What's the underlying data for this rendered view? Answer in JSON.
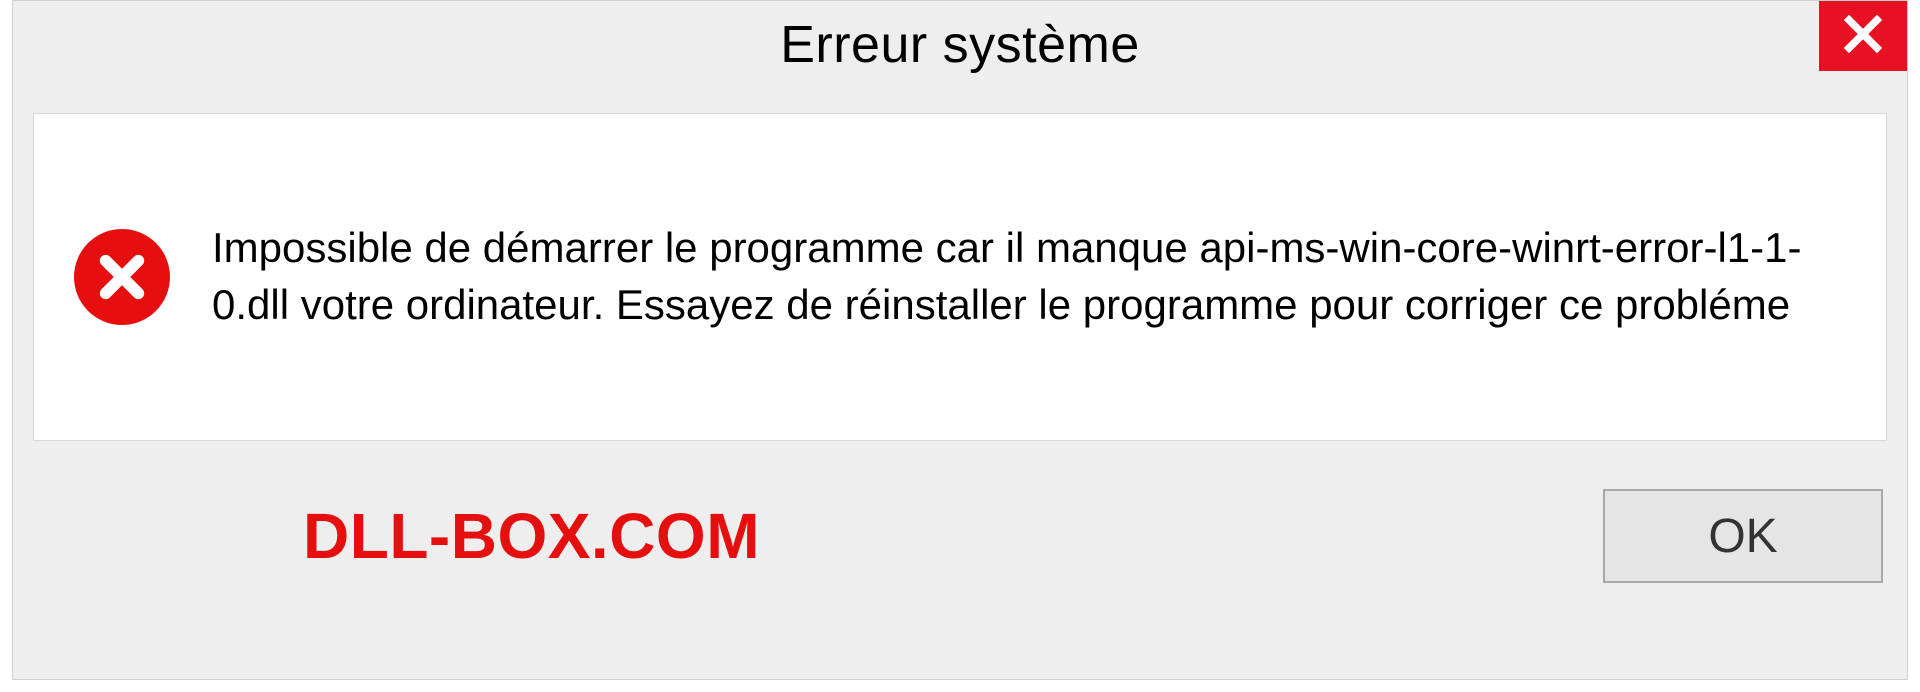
{
  "dialog": {
    "title": "Erreur système",
    "message": "Impossible de démarrer le programme car il manque api-ms-win-core-winrt-error-l1-1-0.dll votre ordinateur. Essayez de réinstaller le programme pour corriger ce probléme",
    "ok_label": "OK",
    "watermark": "DLL-BOX.COM"
  },
  "icons": {
    "close": "close-icon",
    "error": "error-circle-x-icon"
  },
  "colors": {
    "close_bg": "#e81123",
    "error_red": "#e60f0f",
    "dialog_bg": "#eeeeee",
    "message_bg": "#ffffff"
  }
}
